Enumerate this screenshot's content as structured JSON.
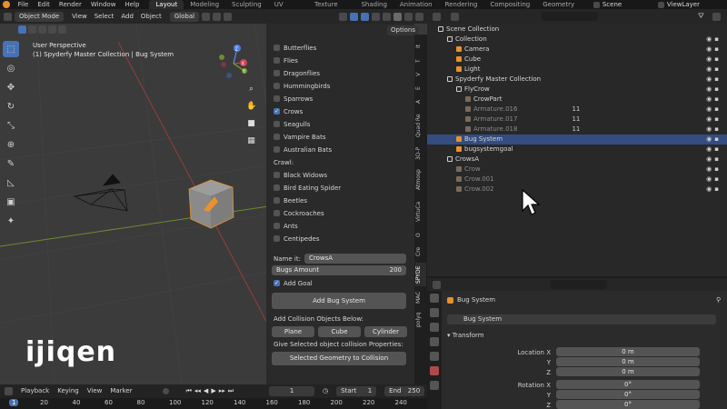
{
  "menu": [
    "File",
    "Edit",
    "Render",
    "Window",
    "Help"
  ],
  "workspaces": [
    "Layout",
    "Modeling",
    "Sculpting",
    "UV Editing",
    "Texture Paint",
    "Shading",
    "Animation",
    "Rendering",
    "Compositing",
    "Geometry Nodes"
  ],
  "scene_label": "Scene",
  "viewlayer_label": "ViewLayer",
  "viewport": {
    "mode": "Object Mode",
    "menus": [
      "View",
      "Select",
      "Add",
      "Object"
    ],
    "orientation": "Global",
    "info_line1": "User Perspective",
    "info_line2": "(1) Spyderfy Master Collection | Bug System",
    "options_label": "Options",
    "gizmo": {
      "x": "X",
      "y": "Y",
      "z": "Z"
    }
  },
  "panel": {
    "fly_items": [
      {
        "label": "Butterflies",
        "checked": false
      },
      {
        "label": "Flies",
        "checked": false
      },
      {
        "label": "Dragonflies",
        "checked": false
      },
      {
        "label": "Hummingbirds",
        "checked": false
      },
      {
        "label": "Sparrows",
        "checked": false
      },
      {
        "label": "Crows",
        "checked": true
      },
      {
        "label": "Seagulls",
        "checked": false
      },
      {
        "label": "Vampire Bats",
        "checked": false
      },
      {
        "label": "Australian Bats",
        "checked": false
      }
    ],
    "crawl_heading": "Crawl:",
    "crawl_items": [
      {
        "label": "Black Widows",
        "checked": false
      },
      {
        "label": "Bird Eating Spider",
        "checked": false
      },
      {
        "label": "Beetles",
        "checked": false
      },
      {
        "label": "Cockroaches",
        "checked": false
      },
      {
        "label": "Ants",
        "checked": false
      },
      {
        "label": "Centipedes",
        "checked": false
      }
    ],
    "name_label": "Name it:",
    "name_value": "CrowsA",
    "bugs_amount_label": "Bugs Amount",
    "bugs_amount_value": "200",
    "add_goal_label": "Add Goal",
    "add_goal_checked": true,
    "add_bug_system": "Add Bug System",
    "collision_heading": "Add Collision Objects Below:",
    "collision_buttons": [
      "Plane",
      "Cube",
      "Cylinder"
    ],
    "collision_props_heading": "Give Selected object collision Properties:",
    "selected_to_collision": "Selected Geometry to Collision"
  },
  "vertical_tabs": [
    "It",
    "T",
    "V",
    "E",
    "A",
    "Quad Re",
    "3D-P",
    "Atmosp",
    "VirtuCa",
    "O",
    "Cre",
    "SPYDE",
    "MAC",
    "polyq"
  ],
  "watermark": "ijiqen",
  "timeline": {
    "menus": [
      "Playback",
      "Keying",
      "View",
      "Marker"
    ],
    "current_frame": "1",
    "start_label": "Start",
    "start_value": "1",
    "end_label": "End",
    "end_value": "250",
    "ruler": [
      "1",
      "20",
      "40",
      "60",
      "80",
      "100",
      "120",
      "140",
      "160",
      "180",
      "200",
      "220",
      "240"
    ]
  },
  "outliner": {
    "rows": [
      {
        "label": "Scene Collection",
        "indent": 0,
        "kind": "scene"
      },
      {
        "label": "Collection",
        "indent": 1,
        "kind": "collection"
      },
      {
        "label": "Camera",
        "indent": 2,
        "kind": "camera"
      },
      {
        "label": "Cube",
        "indent": 2,
        "kind": "mesh"
      },
      {
        "label": "Light",
        "indent": 2,
        "kind": "light"
      },
      {
        "label": "Spyderfy Master Collection",
        "indent": 1,
        "kind": "collection"
      },
      {
        "label": "FlyCrow",
        "indent": 2,
        "kind": "collection"
      },
      {
        "label": "CrowPart",
        "indent": 3,
        "kind": "object"
      },
      {
        "label": "Armature.016",
        "indent": 3,
        "kind": "armature",
        "dim": true,
        "count": "11"
      },
      {
        "label": "Armature.017",
        "indent": 3,
        "kind": "armature",
        "dim": true,
        "count": "11"
      },
      {
        "label": "Armature.018",
        "indent": 3,
        "kind": "armature",
        "dim": true,
        "count": "11"
      },
      {
        "label": "Bug System",
        "indent": 2,
        "kind": "mesh",
        "selected": true
      },
      {
        "label": "bugsystemgoal",
        "indent": 2,
        "kind": "empty"
      },
      {
        "label": "CrowsA",
        "indent": 1,
        "kind": "collection"
      },
      {
        "label": "Crow",
        "indent": 2,
        "kind": "object",
        "dim": true
      },
      {
        "label": "Crow.001",
        "indent": 2,
        "kind": "object",
        "dim": true
      },
      {
        "label": "Crow.002",
        "indent": 2,
        "kind": "object",
        "dim": true
      }
    ]
  },
  "properties": {
    "object_name": "Bug System",
    "data_name": "Bug System",
    "transform_label": "Transform",
    "location": {
      "label": "Location X",
      "y_label": "Y",
      "z_label": "Z",
      "x": "0 m",
      "y": "0 m",
      "z": "0 m"
    },
    "rotation": {
      "label": "Rotation X",
      "y_label": "Y",
      "z_label": "Z",
      "x": "0°",
      "y": "0°",
      "z": "0°"
    }
  },
  "colors": {
    "accent": "#4772b3",
    "selected_row": "#334d80",
    "orange": "#e8912d",
    "grid_x": "#9a3b3b",
    "grid_y": "#6f8a2e"
  }
}
